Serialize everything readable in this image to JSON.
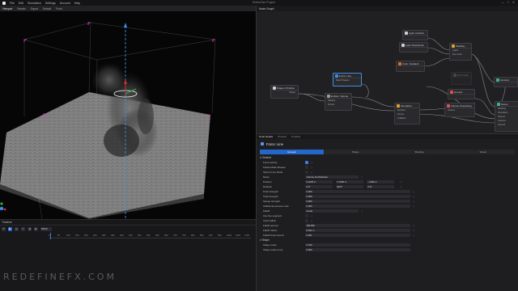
{
  "menu": {
    "items": [
      "File",
      "Edit",
      "Simulation",
      "Settings",
      "Account",
      "Help"
    ],
    "window_title": "EmberGen Project",
    "controls": [
      "—",
      "□",
      "✕"
    ]
  },
  "viewport_toolbar": {
    "tabs": [
      "Viewport",
      "Render",
      "Export"
    ],
    "camera": "Default",
    "view": "Front"
  },
  "timeline": {
    "title": "Timeline",
    "frame_value": "52/24",
    "ruler": [
      "0",
      "50",
      "100",
      "150",
      "200",
      "250",
      "300",
      "350",
      "400",
      "450",
      "500",
      "550",
      "600",
      "650",
      "700",
      "750",
      "800",
      "850",
      "900",
      "950",
      "1000",
      "1050",
      "1100"
    ]
  },
  "watermark": "REDEFINEFX.COM",
  "node_editor": {
    "title": "Node Graph",
    "nodes": {
      "shape_primitive": {
        "title": "Shape: Primitive",
        "rows": [
          "Shape"
        ],
        "color": "#d0d0d0"
      },
      "force_line": {
        "title": "Force: Line",
        "rows": [
          "Mask Shapes"
        ],
        "color": "#3c8ee6"
      },
      "emitter_volume": {
        "title": "Emitter: Volume",
        "rows": [
          "Shapes",
          "Forces"
        ],
        "color": "#9a9a9a"
      },
      "simulation": {
        "title": "Simulation",
        "rows": [
          "Emitters",
          "Forces",
          "Colliders"
        ],
        "color": "#e0a030"
      },
      "light_ambient": {
        "title": "Light: Ambient",
        "rows": [
          "Light"
        ],
        "color": "#d0d0d0"
      },
      "light_directional": {
        "title": "Light: Directional",
        "rows": [
          "Light"
        ],
        "color": "#d0d0d0"
      },
      "color_gradient": {
        "title": "Color: Gradient",
        "rows": [
          "Color"
        ],
        "color": "#d07030"
      },
      "shading": {
        "title": "Shading",
        "rows": [
          "Lights",
          "Smoke",
          "Fire Color"
        ],
        "color": "#e0a030"
      },
      "volume_processing": {
        "title": "Volume Processing",
        "rows": [
          "Volume",
          "Mask Shapes"
        ],
        "color": "#e05050"
      },
      "emit_color": {
        "title": "Emit Color",
        "rows": [
          "Emitters",
          "Mask Shapes"
        ],
        "color": "#777"
      },
      "ground": {
        "title": "Ground",
        "rows": [
          "Shape"
        ],
        "color": "#e05050"
      },
      "camera": {
        "title": "Camera",
        "rows": [
          "Camera"
        ],
        "color": "#40b090"
      },
      "scene": {
        "title": "Scene",
        "rows": [
          "Shading",
          "Simulation",
          "Volume",
          "Camera",
          "Ground",
          "Export"
        ],
        "color": "#40b090"
      }
    }
  },
  "properties": {
    "tabs": [
      "Node Details",
      "Preview",
      "Timeline"
    ],
    "node_title": "Force: Line",
    "subtabs": [
      "General",
      "Shape",
      "Shading",
      "Visual"
    ],
    "section_general": "General",
    "rows": [
      {
        "label": "Force activity",
        "type": "check",
        "on": true
      },
      {
        "label": "Follow Mask Shapes",
        "type": "check",
        "on": false
      },
      {
        "label": "Show Force Mode",
        "type": "check",
        "on": false
      },
      {
        "label": "Mode",
        "type": "select",
        "value": "Volume And Particles"
      },
      {
        "label": "Position",
        "type": "vec3",
        "values": [
          "0.4235 m",
          "0.1065 m",
          "-1.083 m"
        ]
      },
      {
        "label": "Rotation",
        "type": "vec3",
        "values": [
          "0.0°",
          "90.0°",
          "0.0°"
        ]
      },
      {
        "label": "Push strength",
        "type": "value",
        "value": "0.300"
      },
      {
        "label": "Twist strength",
        "type": "value",
        "value": "0.300"
      },
      {
        "label": "Sweep strength",
        "type": "value",
        "value": "0.000"
      },
      {
        "label": "Additional pressure rate",
        "type": "value",
        "value": "0.000"
      },
      {
        "label": "Falloff",
        "type": "select",
        "value": "Linear"
      },
      {
        "label": "Use line segment",
        "type": "check",
        "on": false
      },
      {
        "label": "Invert falloff",
        "type": "check",
        "on": false
      },
      {
        "label": "Falloff percent",
        "type": "value",
        "value": "100.000"
      },
      {
        "label": "Falloff radius",
        "type": "value",
        "value": "0.811 m"
      },
      {
        "label": "Falloff linear bound",
        "type": "value",
        "value": "0.301"
      }
    ],
    "section_shape": "Shape",
    "shape_rows": [
      {
        "label": "Shape scale",
        "value": "0.793"
      },
      {
        "label": "Shape scale (mm)",
        "value": "0.000"
      }
    ]
  }
}
